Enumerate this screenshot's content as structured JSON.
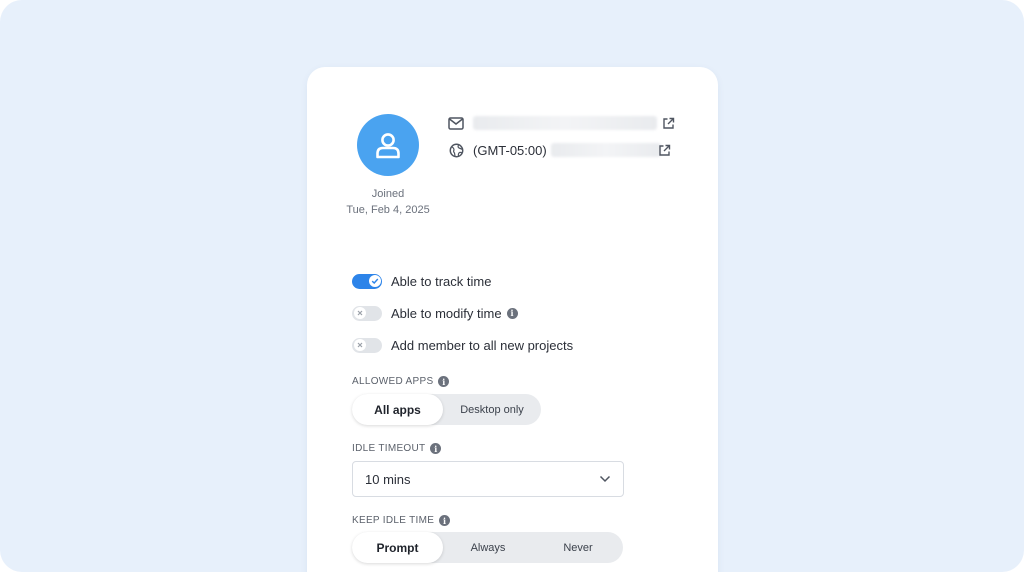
{
  "profile": {
    "joined_label": "Joined",
    "joined_date": "Tue, Feb 4, 2025",
    "timezone": "(GMT-05:00)",
    "email_icon": "mail-icon",
    "timezone_icon": "globe-icon",
    "open_icon": "external-link-icon"
  },
  "toggles": [
    {
      "label": "Able to track time",
      "state": "on"
    },
    {
      "label": "Able to modify time",
      "state": "off"
    },
    {
      "label": "Add member to all new projects",
      "state": "off"
    }
  ],
  "allowed_apps": {
    "label": "ALLOWED APPS",
    "options": [
      "All apps",
      "Desktop only"
    ],
    "selected": "All apps"
  },
  "idle_timeout": {
    "label": "IDLE TIMEOUT",
    "value": "10 mins"
  },
  "keep_idle_time": {
    "label": "KEEP IDLE TIME",
    "options": [
      "Prompt",
      "Always",
      "Never"
    ],
    "selected": "Prompt"
  },
  "colors": {
    "background": "#e7f0fb",
    "accent": "#2d84e9",
    "avatar": "#4aa3f0"
  }
}
